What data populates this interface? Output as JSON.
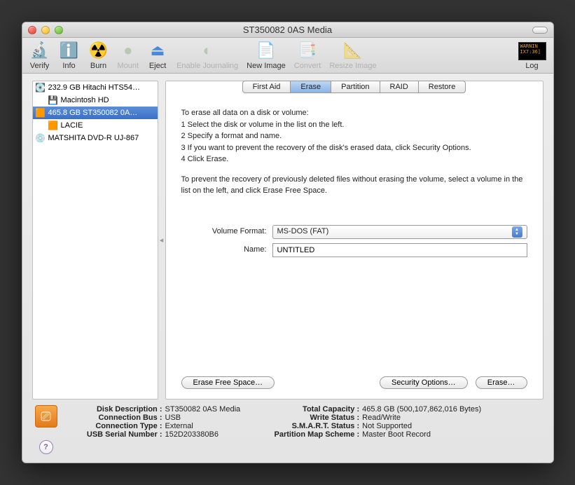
{
  "title": "ST350082 0AS Media",
  "toolbar": {
    "verify": "Verify",
    "info": "Info",
    "burn": "Burn",
    "mount": "Mount",
    "eject": "Eject",
    "enable_journaling": "Enable Journaling",
    "new_image": "New Image",
    "convert": "Convert",
    "resize_image": "Resize Image",
    "log": "Log",
    "log_badge": "WARNIN\nIX7:36]"
  },
  "sidebar": {
    "items": [
      {
        "label": "232.9 GB Hitachi HTS54…",
        "icon": "hdd",
        "indent": 0,
        "sel": false
      },
      {
        "label": "Macintosh HD",
        "icon": "vol",
        "indent": 1,
        "sel": false
      },
      {
        "label": "465.8 GB ST350082 0A…",
        "icon": "ext",
        "indent": 0,
        "sel": true
      },
      {
        "label": "LACIE",
        "icon": "ext",
        "indent": 1,
        "sel": false
      },
      {
        "label": "MATSHITA DVD-R UJ-867",
        "icon": "dvd",
        "indent": 0,
        "sel": false
      }
    ]
  },
  "tabs": {
    "items": [
      "First Aid",
      "Erase",
      "Partition",
      "RAID",
      "Restore"
    ],
    "active": 1
  },
  "erase": {
    "intro": "To erase all data on a disk or volume:",
    "s1": "1  Select the disk or volume in the list on the left.",
    "s2": "2  Specify a format and name.",
    "s3": "3  If you want to prevent the recovery of the disk's erased data, click Security Options.",
    "s4": "4  Click Erase.",
    "para2": "To prevent the recovery of previously deleted files without erasing the volume, select a volume in the list on the left, and click Erase Free Space.",
    "vol_format_label": "Volume Format:",
    "vol_format_value": "MS-DOS (FAT)",
    "name_label": "Name:",
    "name_value": "UNTITLED",
    "erase_free": "Erase Free Space…",
    "sec_opts": "Security Options…",
    "erase_btn": "Erase…"
  },
  "info": {
    "k1": "Disk Description :",
    "v1": "ST350082 0AS Media",
    "k2": "Connection Bus :",
    "v2": "USB",
    "k3": "Connection Type :",
    "v3": "External",
    "k4": "USB Serial Number :",
    "v4": "152D203380B6",
    "k5": "Total Capacity :",
    "v5": "465.8 GB (500,107,862,016 Bytes)",
    "k6": "Write Status :",
    "v6": "Read/Write",
    "k7": "S.M.A.R.T. Status :",
    "v7": "Not Supported",
    "k8": "Partition Map Scheme :",
    "v8": "Master Boot Record"
  }
}
